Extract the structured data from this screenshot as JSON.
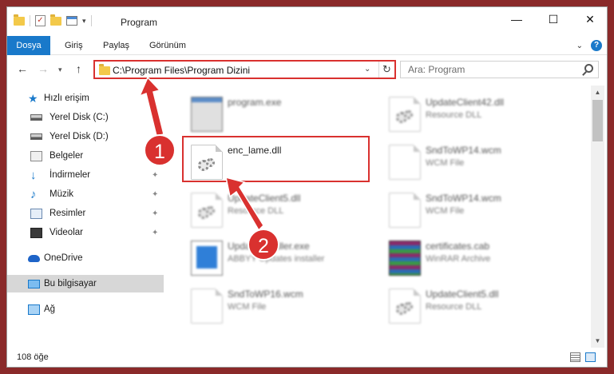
{
  "window": {
    "title": "Program",
    "controls": {
      "minimize": "—",
      "maximize": "☐",
      "close": "✕"
    }
  },
  "ribbon": {
    "tabs": [
      "Dosya",
      "Giriş",
      "Paylaş",
      "Görünüm"
    ],
    "help": "?"
  },
  "nav": {
    "address": "C:\\Program Files\\Program Dizini",
    "search_placeholder": "Ara: Program"
  },
  "sidebar": {
    "items": [
      {
        "label": "Hızlı erişim",
        "icon": "star-icon",
        "pinned": false
      },
      {
        "label": "Yerel Disk (C:)",
        "icon": "drive-icon",
        "pinned": false
      },
      {
        "label": "Yerel Disk (D:)",
        "icon": "drive-icon",
        "pinned": false
      },
      {
        "label": "Belgeler",
        "icon": "documents-icon",
        "pinned": true
      },
      {
        "label": "İndirmeler",
        "icon": "download-icon",
        "pinned": true
      },
      {
        "label": "Müzik",
        "icon": "music-icon",
        "pinned": true
      },
      {
        "label": "Resimler",
        "icon": "pictures-icon",
        "pinned": true
      },
      {
        "label": "Videolar",
        "icon": "video-icon",
        "pinned": true
      },
      {
        "label": "OneDrive",
        "icon": "onedrive-icon",
        "pinned": false
      },
      {
        "label": "Bu bilgisayar",
        "icon": "computer-icon",
        "pinned": false,
        "selected": true
      },
      {
        "label": "Ağ",
        "icon": "network-icon",
        "pinned": false
      }
    ]
  },
  "files": {
    "left": [
      {
        "name": "program.exe",
        "type": "",
        "icon": "exe-icon"
      },
      {
        "name": "enc_lame.dll",
        "type": "",
        "icon": "dll-gear-icon",
        "highlighted": true
      },
      {
        "name": "UpdateClient5.dll",
        "type": "Resource DLL",
        "icon": "dll-gear-icon"
      },
      {
        "name": "UpdateInstaller.exe",
        "type": "ABBYY Updates installer",
        "icon": "installer-icon"
      },
      {
        "name": "SndToWP16.wcm",
        "type": "WCM File",
        "icon": "document-icon"
      }
    ],
    "right": [
      {
        "name": "UpdateClient42.dll",
        "type": "Resource DLL",
        "icon": "dll-gear-icon"
      },
      {
        "name": "SndToWP14.wcm",
        "type": "WCM File",
        "icon": "document-icon"
      },
      {
        "name": "SndToWP14.wcm",
        "type": "WCM File",
        "icon": "document-icon"
      },
      {
        "name": "certificates.cab",
        "type": "WinRAR Archive",
        "icon": "archive-icon"
      },
      {
        "name": "UpdateClient5.dll",
        "type": "Resource DLL",
        "icon": "dll-gear-icon"
      }
    ]
  },
  "status": {
    "count": "108 öğe"
  },
  "steps": [
    "1",
    "2"
  ],
  "colors": {
    "accent": "#1979ca",
    "highlight": "#d9312f"
  }
}
